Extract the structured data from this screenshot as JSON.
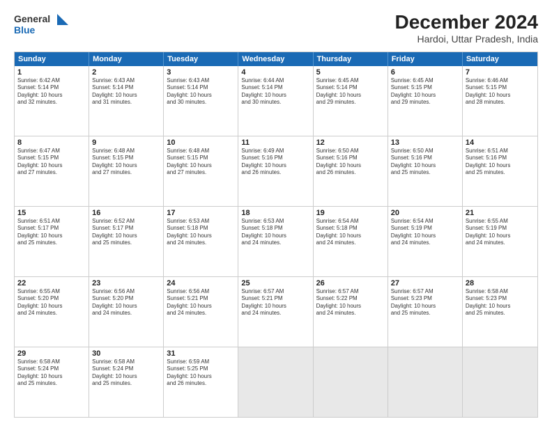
{
  "logo": {
    "line1": "General",
    "line2": "Blue"
  },
  "title": "December 2024",
  "subtitle": "Hardoi, Uttar Pradesh, India",
  "days": [
    "Sunday",
    "Monday",
    "Tuesday",
    "Wednesday",
    "Thursday",
    "Friday",
    "Saturday"
  ],
  "weeks": [
    [
      {
        "day": "1",
        "info": "Sunrise: 6:42 AM\nSunset: 5:14 PM\nDaylight: 10 hours\nand 32 minutes."
      },
      {
        "day": "2",
        "info": "Sunrise: 6:43 AM\nSunset: 5:14 PM\nDaylight: 10 hours\nand 31 minutes."
      },
      {
        "day": "3",
        "info": "Sunrise: 6:43 AM\nSunset: 5:14 PM\nDaylight: 10 hours\nand 30 minutes."
      },
      {
        "day": "4",
        "info": "Sunrise: 6:44 AM\nSunset: 5:14 PM\nDaylight: 10 hours\nand 30 minutes."
      },
      {
        "day": "5",
        "info": "Sunrise: 6:45 AM\nSunset: 5:14 PM\nDaylight: 10 hours\nand 29 minutes."
      },
      {
        "day": "6",
        "info": "Sunrise: 6:45 AM\nSunset: 5:15 PM\nDaylight: 10 hours\nand 29 minutes."
      },
      {
        "day": "7",
        "info": "Sunrise: 6:46 AM\nSunset: 5:15 PM\nDaylight: 10 hours\nand 28 minutes."
      }
    ],
    [
      {
        "day": "8",
        "info": "Sunrise: 6:47 AM\nSunset: 5:15 PM\nDaylight: 10 hours\nand 27 minutes."
      },
      {
        "day": "9",
        "info": "Sunrise: 6:48 AM\nSunset: 5:15 PM\nDaylight: 10 hours\nand 27 minutes."
      },
      {
        "day": "10",
        "info": "Sunrise: 6:48 AM\nSunset: 5:15 PM\nDaylight: 10 hours\nand 27 minutes."
      },
      {
        "day": "11",
        "info": "Sunrise: 6:49 AM\nSunset: 5:16 PM\nDaylight: 10 hours\nand 26 minutes."
      },
      {
        "day": "12",
        "info": "Sunrise: 6:50 AM\nSunset: 5:16 PM\nDaylight: 10 hours\nand 26 minutes."
      },
      {
        "day": "13",
        "info": "Sunrise: 6:50 AM\nSunset: 5:16 PM\nDaylight: 10 hours\nand 25 minutes."
      },
      {
        "day": "14",
        "info": "Sunrise: 6:51 AM\nSunset: 5:16 PM\nDaylight: 10 hours\nand 25 minutes."
      }
    ],
    [
      {
        "day": "15",
        "info": "Sunrise: 6:51 AM\nSunset: 5:17 PM\nDaylight: 10 hours\nand 25 minutes."
      },
      {
        "day": "16",
        "info": "Sunrise: 6:52 AM\nSunset: 5:17 PM\nDaylight: 10 hours\nand 25 minutes."
      },
      {
        "day": "17",
        "info": "Sunrise: 6:53 AM\nSunset: 5:18 PM\nDaylight: 10 hours\nand 24 minutes."
      },
      {
        "day": "18",
        "info": "Sunrise: 6:53 AM\nSunset: 5:18 PM\nDaylight: 10 hours\nand 24 minutes."
      },
      {
        "day": "19",
        "info": "Sunrise: 6:54 AM\nSunset: 5:18 PM\nDaylight: 10 hours\nand 24 minutes."
      },
      {
        "day": "20",
        "info": "Sunrise: 6:54 AM\nSunset: 5:19 PM\nDaylight: 10 hours\nand 24 minutes."
      },
      {
        "day": "21",
        "info": "Sunrise: 6:55 AM\nSunset: 5:19 PM\nDaylight: 10 hours\nand 24 minutes."
      }
    ],
    [
      {
        "day": "22",
        "info": "Sunrise: 6:55 AM\nSunset: 5:20 PM\nDaylight: 10 hours\nand 24 minutes."
      },
      {
        "day": "23",
        "info": "Sunrise: 6:56 AM\nSunset: 5:20 PM\nDaylight: 10 hours\nand 24 minutes."
      },
      {
        "day": "24",
        "info": "Sunrise: 6:56 AM\nSunset: 5:21 PM\nDaylight: 10 hours\nand 24 minutes."
      },
      {
        "day": "25",
        "info": "Sunrise: 6:57 AM\nSunset: 5:21 PM\nDaylight: 10 hours\nand 24 minutes."
      },
      {
        "day": "26",
        "info": "Sunrise: 6:57 AM\nSunset: 5:22 PM\nDaylight: 10 hours\nand 24 minutes."
      },
      {
        "day": "27",
        "info": "Sunrise: 6:57 AM\nSunset: 5:23 PM\nDaylight: 10 hours\nand 25 minutes."
      },
      {
        "day": "28",
        "info": "Sunrise: 6:58 AM\nSunset: 5:23 PM\nDaylight: 10 hours\nand 25 minutes."
      }
    ],
    [
      {
        "day": "29",
        "info": "Sunrise: 6:58 AM\nSunset: 5:24 PM\nDaylight: 10 hours\nand 25 minutes."
      },
      {
        "day": "30",
        "info": "Sunrise: 6:58 AM\nSunset: 5:24 PM\nDaylight: 10 hours\nand 25 minutes."
      },
      {
        "day": "31",
        "info": "Sunrise: 6:59 AM\nSunset: 5:25 PM\nDaylight: 10 hours\nand 26 minutes."
      },
      {
        "day": "",
        "info": ""
      },
      {
        "day": "",
        "info": ""
      },
      {
        "day": "",
        "info": ""
      },
      {
        "day": "",
        "info": ""
      }
    ]
  ]
}
